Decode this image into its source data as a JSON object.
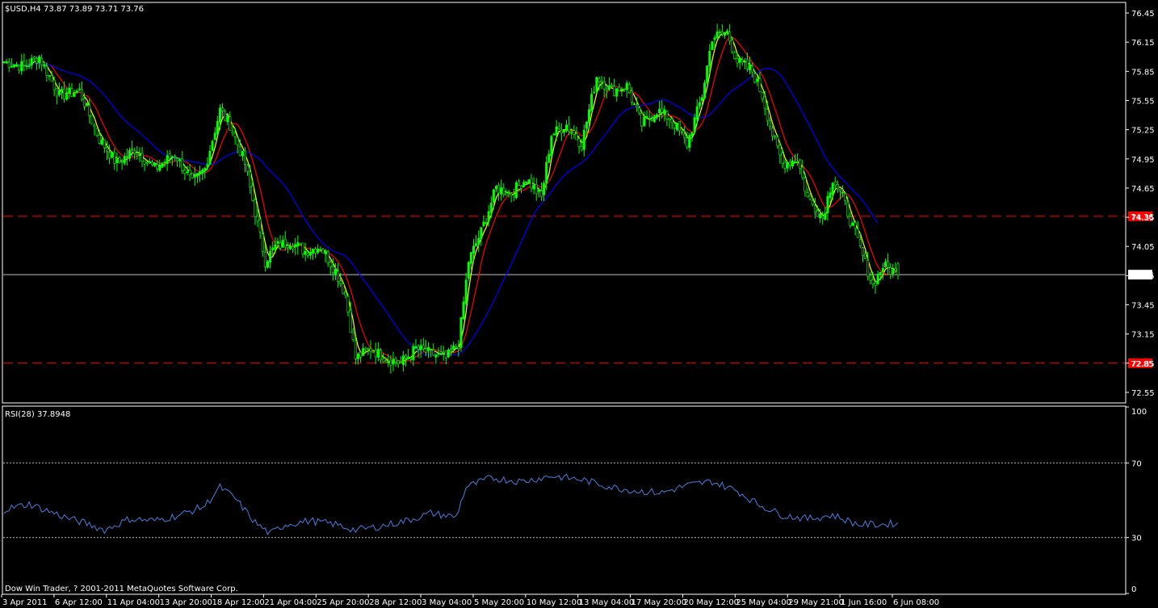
{
  "window": {
    "symbol_header": "$USD,H4  73.87 73.89 73.71 73.76",
    "copyright": "Dow Win Trader, ? 2001-2011 MetaQuotes Software Corp."
  },
  "colors": {
    "background": "#000000",
    "frame": "#ffffff",
    "bull_candle": "#00ff00",
    "bear_candle": "#00ff00",
    "ma_fast": "#ffff00",
    "ma_mid": "#ff0000",
    "ma_slow": "#0000ff",
    "rsi_line": "#4a7fe0",
    "resistance": "#ff0000",
    "price_line": "#c0c0c0"
  },
  "chart_data": [
    {
      "type": "candlestick",
      "symbol": "$USD",
      "timeframe": "H4",
      "ohlc_last": {
        "open": 73.87,
        "high": 73.89,
        "low": 73.71,
        "close": 73.76
      },
      "ylim": [
        72.45,
        76.55
      ],
      "yticks": [
        "76.45",
        "76.15",
        "75.85",
        "75.55",
        "75.25",
        "74.95",
        "74.65",
        "74.35",
        "74.05",
        "73.75",
        "73.45",
        "73.15",
        "72.85",
        "72.55"
      ],
      "xticks": [
        "3 Apr 2011",
        "6 Apr 12:00",
        "11 Apr 04:00",
        "13 Apr 20:00",
        "18 Apr 12:00",
        "21 Apr 04:00",
        "25 Apr 20:00",
        "28 Apr 12:00",
        "3 May 04:00",
        "5 May 20:00",
        "10 May 12:00",
        "13 May 04:00",
        "17 May 20:00",
        "20 May 12:00",
        "25 May 04:00",
        "29 May 21:00",
        "1 Jun 16:00",
        "6 Jun 08:00"
      ],
      "hlines": [
        {
          "value": 74.36,
          "label": "74.36",
          "style": "dashed",
          "color": "#ff0000"
        },
        {
          "value": 72.85,
          "label": "72.85",
          "style": "dashed",
          "color": "#ff0000"
        },
        {
          "value": 73.76,
          "label": "73.76",
          "style": "solid",
          "color": "#c0c0c0"
        }
      ],
      "close_series_keypoints": [
        [
          0,
          75.95
        ],
        [
          8,
          75.9
        ],
        [
          14,
          76.0
        ],
        [
          22,
          75.6
        ],
        [
          30,
          75.65
        ],
        [
          38,
          75.15
        ],
        [
          45,
          74.9
        ],
        [
          52,
          75.05
        ],
        [
          60,
          74.85
        ],
        [
          68,
          75.0
        ],
        [
          75,
          74.7
        ],
        [
          80,
          74.85
        ],
        [
          86,
          75.45
        ],
        [
          90,
          75.3
        ],
        [
          96,
          74.9
        ],
        [
          100,
          74.4
        ],
        [
          104,
          73.9
        ],
        [
          108,
          74.05
        ],
        [
          114,
          74.1
        ],
        [
          120,
          74.0
        ],
        [
          126,
          74.05
        ],
        [
          132,
          73.8
        ],
        [
          136,
          73.55
        ],
        [
          140,
          72.9
        ],
        [
          146,
          73.0
        ],
        [
          152,
          72.9
        ],
        [
          158,
          72.85
        ],
        [
          164,
          73.0
        ],
        [
          170,
          72.95
        ],
        [
          176,
          72.9
        ],
        [
          181,
          73.05
        ],
        [
          185,
          73.9
        ],
        [
          190,
          74.2
        ],
        [
          196,
          74.65
        ],
        [
          202,
          74.6
        ],
        [
          208,
          74.75
        ],
        [
          214,
          74.55
        ],
        [
          218,
          75.2
        ],
        [
          224,
          75.3
        ],
        [
          230,
          75.1
        ],
        [
          236,
          75.8
        ],
        [
          242,
          75.65
        ],
        [
          248,
          75.7
        ],
        [
          254,
          75.3
        ],
        [
          260,
          75.45
        ],
        [
          266,
          75.35
        ],
        [
          272,
          75.1
        ],
        [
          278,
          75.6
        ],
        [
          282,
          76.2
        ],
        [
          288,
          76.25
        ],
        [
          292,
          75.95
        ],
        [
          298,
          75.85
        ],
        [
          302,
          75.6
        ],
        [
          306,
          75.2
        ],
        [
          310,
          74.9
        ],
        [
          316,
          74.95
        ],
        [
          320,
          74.55
        ],
        [
          326,
          74.35
        ],
        [
          330,
          74.75
        ],
        [
          334,
          74.55
        ],
        [
          338,
          74.25
        ],
        [
          342,
          73.95
        ],
        [
          346,
          73.65
        ],
        [
          350,
          73.85
        ],
        [
          356,
          73.76
        ]
      ]
    },
    {
      "type": "line",
      "title": "RSI(28) 37.8948",
      "ylim": [
        0,
        100
      ],
      "yticks": [
        "100",
        "70",
        "30",
        "0"
      ],
      "levels": [
        70,
        30
      ],
      "values_keypoints": [
        [
          0,
          45
        ],
        [
          10,
          48
        ],
        [
          18,
          44
        ],
        [
          24,
          41
        ],
        [
          34,
          37
        ],
        [
          40,
          34
        ],
        [
          50,
          40
        ],
        [
          60,
          39
        ],
        [
          70,
          42
        ],
        [
          80,
          47
        ],
        [
          86,
          57
        ],
        [
          92,
          51
        ],
        [
          100,
          38
        ],
        [
          106,
          32
        ],
        [
          112,
          37
        ],
        [
          122,
          39
        ],
        [
          132,
          37
        ],
        [
          140,
          34
        ],
        [
          150,
          36
        ],
        [
          160,
          39
        ],
        [
          170,
          43
        ],
        [
          180,
          41
        ],
        [
          184,
          57
        ],
        [
          194,
          62
        ],
        [
          206,
          60
        ],
        [
          218,
          63
        ],
        [
          230,
          61
        ],
        [
          242,
          57
        ],
        [
          252,
          55
        ],
        [
          262,
          54
        ],
        [
          272,
          58
        ],
        [
          282,
          60
        ],
        [
          292,
          55
        ],
        [
          300,
          48
        ],
        [
          310,
          42
        ],
        [
          320,
          40
        ],
        [
          330,
          42
        ],
        [
          340,
          37
        ],
        [
          350,
          37
        ],
        [
          356,
          37.89
        ]
      ]
    }
  ]
}
